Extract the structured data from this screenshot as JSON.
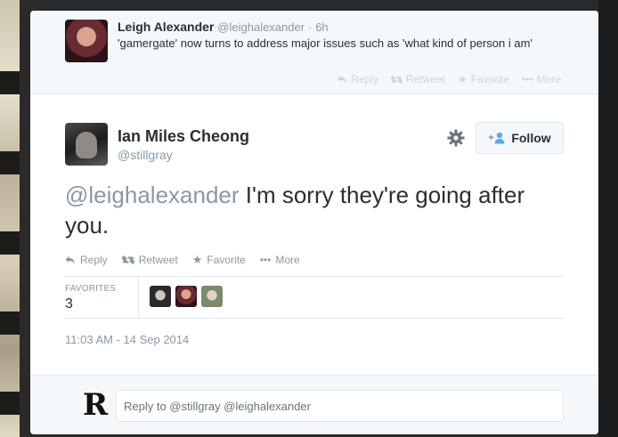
{
  "context_tweet": {
    "fullname": "Leigh Alexander",
    "handle": "@leighalexander",
    "time": "6h",
    "text": "'gamergate' now turns to address major issues such as 'what kind of person i am'",
    "actions": {
      "reply": "Reply",
      "retweet": "Retweet",
      "favorite": "Favorite",
      "more": "More"
    }
  },
  "main_tweet": {
    "fullname": "Ian Miles Cheong",
    "handle": "@stillgray",
    "follow_label": "Follow",
    "mention": "@leighalexander",
    "text": " I'm sorry they're going after you.",
    "actions": {
      "reply": "Reply",
      "retweet": "Retweet",
      "favorite": "Favorite",
      "more": "More"
    },
    "favorites_label": "FAVORITES",
    "favorites_count": "3",
    "timestamp": "11:03 AM - 14 Sep 2014"
  },
  "reply_box": {
    "avatar_letter": "R",
    "placeholder": "Reply to @stillgray @leighalexander"
  },
  "colors": {
    "accent": "#55acee",
    "muted": "#8899a6",
    "text": "#292f33"
  },
  "icons": [
    "reply-icon",
    "retweet-icon",
    "star-icon",
    "more-dots-icon",
    "gear-icon",
    "follow-person-icon"
  ]
}
